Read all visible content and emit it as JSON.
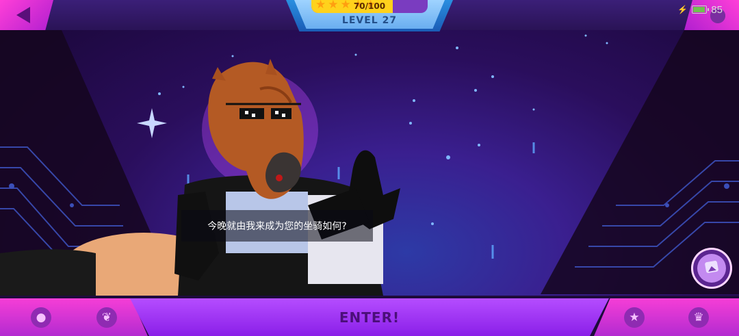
{
  "status": {
    "battery": "85"
  },
  "level": {
    "xp_text": "70/100",
    "xp_fraction": 0.7,
    "level_label": "LEVEL 27"
  },
  "dialog": {
    "subtitle": "今晚就由我来成为您的坐骑如何?"
  },
  "bottom": {
    "enter_label": "ENTER!"
  },
  "icons": {
    "back": "back-arrow-icon",
    "settings": "gear-icon",
    "album": "photo-album-icon",
    "nav": [
      "profile-icon",
      "leaf-icon",
      "star-icon",
      "trophy-icon"
    ]
  },
  "colors": {
    "accent": "#f63ed6",
    "enter": "#a23bf5",
    "xp": "#ffd21c",
    "level_plate": "#2a8fe0"
  }
}
